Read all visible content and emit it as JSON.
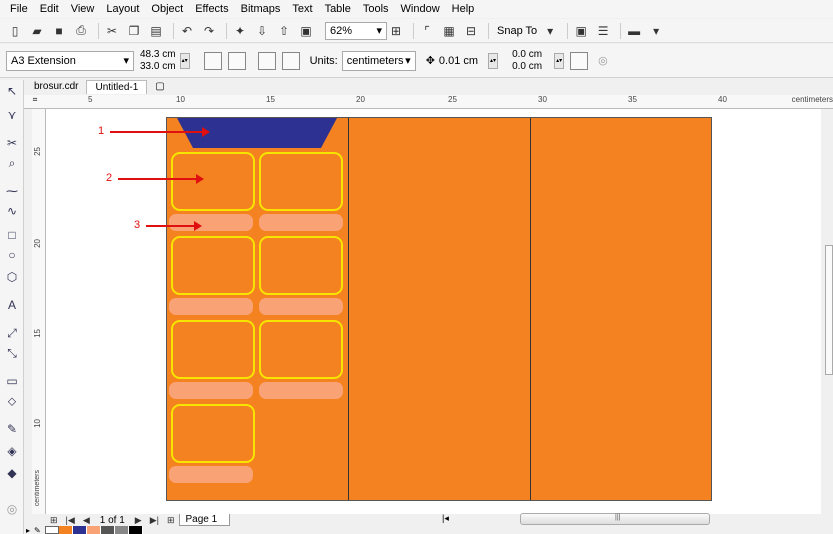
{
  "menu": {
    "items": [
      "File",
      "Edit",
      "View",
      "Layout",
      "Object",
      "Effects",
      "Bitmaps",
      "Text",
      "Table",
      "Tools",
      "Window",
      "Help"
    ]
  },
  "toolbar": {
    "zoom_value": "62%",
    "snap_label": "Snap To"
  },
  "propbar": {
    "page_preset": "A3 Extension",
    "width": "48.3 cm",
    "height": "33.0 cm",
    "units_label": "Units:",
    "units_value": "centimeters",
    "nudge": "0.01 cm",
    "dup_x": "0.0 cm",
    "dup_y": "0.0 cm"
  },
  "tabs": [
    "brosur.cdr",
    "Untitled-1"
  ],
  "ruler": {
    "h_ticks": [
      "5",
      "10",
      "15",
      "20",
      "25",
      "30",
      "35",
      "40"
    ],
    "v_ticks": [
      "25",
      "20",
      "15",
      "10"
    ],
    "units": "centimeters"
  },
  "annotations": [
    "1",
    "2",
    "3"
  ],
  "pagebar": {
    "count": "1 of 1",
    "page_name": "Page 1"
  },
  "colors": {
    "page_orange": "#f58220",
    "banner_blue": "#2d3191",
    "card_border": "#f7e400",
    "caption_fill": "#f9a275",
    "annotation_red": "#e01010"
  }
}
